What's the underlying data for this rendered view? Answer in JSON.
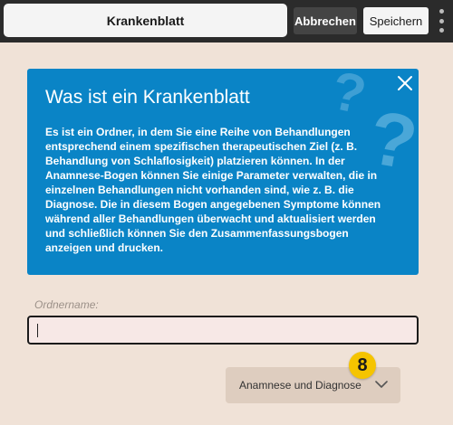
{
  "header": {
    "title": "Krankenblatt",
    "cancel_label": "Abbrechen",
    "save_label": "Speichern",
    "menu_icon": "kebab-menu-icon"
  },
  "info": {
    "title": "Was ist ein Krankenblatt",
    "body": "Es ist ein Ordner, in dem Sie eine Reihe von Behandlungen entsprechend einem spezifischen therapeutischen Ziel (z. B. Behandlung von Schlaflosigkeit) platzieren können. In der Anamnese-Bogen können Sie einige Parameter verwalten, die in einzelnen Behandlungen nicht vorhanden sind, wie z. B. die Diagnose. Die in diesem Bogen angegebenen Symptome können während aller Behandlungen überwacht und aktualisiert werden und schließlich können Sie den Zusammenfassungsbogen anzeigen und drucken.",
    "close_icon": "close-icon",
    "decoration_icon": "question-mark-icon"
  },
  "form": {
    "folder_label": "Ordnername:",
    "folder_value": ""
  },
  "dropdown": {
    "selected": "Anamnese und Diagnose",
    "icon": "chevron-down-icon"
  },
  "badge": {
    "value": "8"
  },
  "colors": {
    "background": "#f0e2d7",
    "topbar": "#2b2b2b",
    "info_box": "#0a84c6",
    "badge": "#f5c400",
    "dropdown": "#decdbf",
    "input_bg": "#f7e8e6"
  }
}
